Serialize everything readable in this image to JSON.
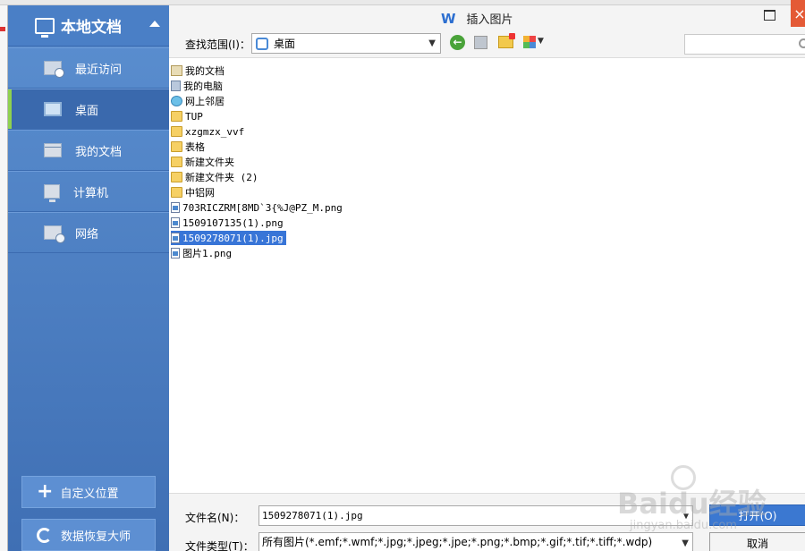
{
  "dialog": {
    "title": "插入图片",
    "logo": "W",
    "close_glyph": "×"
  },
  "sidebar": {
    "header": "本地文档",
    "items": [
      {
        "label": "最近访问",
        "icon": "recent-icon"
      },
      {
        "label": "桌面",
        "icon": "desktop-icon",
        "active": true
      },
      {
        "label": "我的文档",
        "icon": "documents-icon"
      },
      {
        "label": "计算机",
        "icon": "computer-icon"
      },
      {
        "label": "网络",
        "icon": "network-icon"
      }
    ],
    "custom_location": "自定义位置",
    "data_recovery": "数据恢复大师"
  },
  "toolbar": {
    "look_in_label": "查找范围(I)：",
    "look_in_value": "桌面",
    "back_glyph": "←"
  },
  "files": [
    {
      "name": "我的文档",
      "type": "doc"
    },
    {
      "name": "我的电脑",
      "type": "pc"
    },
    {
      "name": "网上邻居",
      "type": "net"
    },
    {
      "name": "TUP",
      "type": "folder"
    },
    {
      "name": "xzgmzx_vvf",
      "type": "folder"
    },
    {
      "name": "表格",
      "type": "folder"
    },
    {
      "name": "新建文件夹",
      "type": "folder"
    },
    {
      "name": "新建文件夹 (2)",
      "type": "folder"
    },
    {
      "name": "中铝网",
      "type": "folder"
    },
    {
      "name": "703RICZRM[8MD`3{%J@PZ_M.png",
      "type": "img"
    },
    {
      "name": "1509107135(1).png",
      "type": "img"
    },
    {
      "name": "1509278071(1).jpg",
      "type": "img",
      "selected": true
    },
    {
      "name": "图片1.png",
      "type": "img"
    }
  ],
  "bottom": {
    "filename_label": "文件名(N)：",
    "filename_value": "1509278071(1).jpg",
    "filetype_label": "文件类型(T)：",
    "filetype_value": "所有图片(*.emf;*.wmf;*.jpg;*.jpeg;*.jpe;*.png;*.bmp;*.gif;*.tif;*.tiff;*.wdp)",
    "open_button": "打开(O)",
    "cancel_button": "取消"
  },
  "watermark": {
    "main": "Baidu经验",
    "sub": "jingyan.baidu.com"
  }
}
